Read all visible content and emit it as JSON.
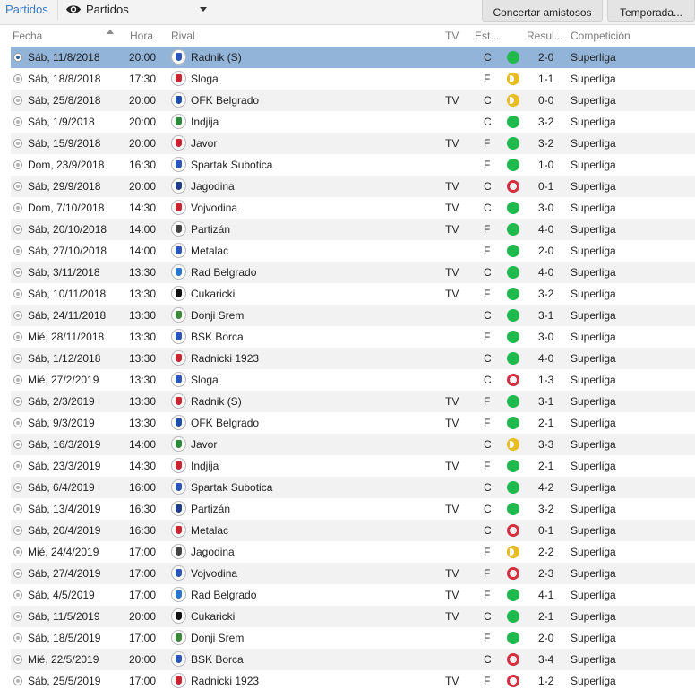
{
  "toolbar": {
    "tab_label": "Partidos",
    "view_label": "Partidos",
    "arrange_friendlies_label": "Concertar amistosos",
    "season_label": "Temporada..."
  },
  "columns": {
    "fecha": "Fecha",
    "hora": "Hora",
    "rival": "Rival",
    "tv": "TV",
    "estadio": "Est...",
    "resultado": "Resul...",
    "competicion": "Competición"
  },
  "colors": {
    "win": "#21b84c",
    "loss": "#d32f3e",
    "draw": "#e8bd23",
    "selected_row": "#92b4d9",
    "accent": "#3a7bc8"
  },
  "matches": [
    {
      "date": "Sáb, 11/8/2018",
      "time": "20:00",
      "rival": "Radnik (S)",
      "tv": "",
      "venue": "C",
      "outcome": "W",
      "score": "2-0",
      "comp": "Superliga"
    },
    {
      "date": "Sáb, 18/8/2018",
      "time": "17:30",
      "rival": "Sloga",
      "tv": "",
      "venue": "F",
      "outcome": "D",
      "score": "1-1",
      "comp": "Superliga"
    },
    {
      "date": "Sáb, 25/8/2018",
      "time": "20:00",
      "rival": "OFK Belgrado",
      "tv": "TV",
      "venue": "C",
      "outcome": "D",
      "score": "0-0",
      "comp": "Superliga"
    },
    {
      "date": "Sáb, 1/9/2018",
      "time": "20:00",
      "rival": "Indjija",
      "tv": "",
      "venue": "C",
      "outcome": "W",
      "score": "3-2",
      "comp": "Superliga"
    },
    {
      "date": "Sáb, 15/9/2018",
      "time": "20:00",
      "rival": "Javor",
      "tv": "TV",
      "venue": "F",
      "outcome": "W",
      "score": "3-2",
      "comp": "Superliga"
    },
    {
      "date": "Dom, 23/9/2018",
      "time": "16:30",
      "rival": "Spartak Subotica",
      "tv": "",
      "venue": "F",
      "outcome": "W",
      "score": "1-0",
      "comp": "Superliga"
    },
    {
      "date": "Sáb, 29/9/2018",
      "time": "20:00",
      "rival": "Jagodina",
      "tv": "TV",
      "venue": "C",
      "outcome": "L",
      "score": "0-1",
      "comp": "Superliga"
    },
    {
      "date": "Dom, 7/10/2018",
      "time": "14:30",
      "rival": "Vojvodina",
      "tv": "TV",
      "venue": "C",
      "outcome": "W",
      "score": "3-0",
      "comp": "Superliga"
    },
    {
      "date": "Sáb, 20/10/2018",
      "time": "14:00",
      "rival": "Partizán",
      "tv": "TV",
      "venue": "F",
      "outcome": "W",
      "score": "4-0",
      "comp": "Superliga"
    },
    {
      "date": "Sáb, 27/10/2018",
      "time": "14:00",
      "rival": "Metalac",
      "tv": "",
      "venue": "F",
      "outcome": "W",
      "score": "2-0",
      "comp": "Superliga"
    },
    {
      "date": "Sáb, 3/11/2018",
      "time": "13:30",
      "rival": "Rad Belgrado",
      "tv": "TV",
      "venue": "C",
      "outcome": "W",
      "score": "4-0",
      "comp": "Superliga"
    },
    {
      "date": "Sáb, 10/11/2018",
      "time": "13:30",
      "rival": "Cukaricki",
      "tv": "TV",
      "venue": "F",
      "outcome": "W",
      "score": "3-2",
      "comp": "Superliga"
    },
    {
      "date": "Sáb, 24/11/2018",
      "time": "13:30",
      "rival": "Donji Srem",
      "tv": "",
      "venue": "C",
      "outcome": "W",
      "score": "3-1",
      "comp": "Superliga"
    },
    {
      "date": "Mié, 28/11/2018",
      "time": "13:30",
      "rival": "BSK Borca",
      "tv": "",
      "venue": "F",
      "outcome": "W",
      "score": "3-0",
      "comp": "Superliga"
    },
    {
      "date": "Sáb, 1/12/2018",
      "time": "13:30",
      "rival": "Radnicki 1923",
      "tv": "",
      "venue": "C",
      "outcome": "W",
      "score": "4-0",
      "comp": "Superliga"
    },
    {
      "date": "Mié, 27/2/2019",
      "time": "13:30",
      "rival": "Sloga",
      "tv": "",
      "venue": "C",
      "outcome": "L",
      "score": "1-3",
      "comp": "Superliga"
    },
    {
      "date": "Sáb, 2/3/2019",
      "time": "13:30",
      "rival": "Radnik (S)",
      "tv": "TV",
      "venue": "F",
      "outcome": "W",
      "score": "3-1",
      "comp": "Superliga"
    },
    {
      "date": "Sáb, 9/3/2019",
      "time": "13:30",
      "rival": "OFK Belgrado",
      "tv": "TV",
      "venue": "F",
      "outcome": "W",
      "score": "2-1",
      "comp": "Superliga"
    },
    {
      "date": "Sáb, 16/3/2019",
      "time": "14:00",
      "rival": "Javor",
      "tv": "",
      "venue": "C",
      "outcome": "D",
      "score": "3-3",
      "comp": "Superliga"
    },
    {
      "date": "Sáb, 23/3/2019",
      "time": "14:30",
      "rival": "Indjija",
      "tv": "TV",
      "venue": "F",
      "outcome": "W",
      "score": "2-1",
      "comp": "Superliga"
    },
    {
      "date": "Sáb, 6/4/2019",
      "time": "16:00",
      "rival": "Spartak Subotica",
      "tv": "",
      "venue": "C",
      "outcome": "W",
      "score": "4-2",
      "comp": "Superliga"
    },
    {
      "date": "Sáb, 13/4/2019",
      "time": "16:30",
      "rival": "Partizán",
      "tv": "TV",
      "venue": "C",
      "outcome": "W",
      "score": "3-2",
      "comp": "Superliga"
    },
    {
      "date": "Sáb, 20/4/2019",
      "time": "16:30",
      "rival": "Metalac",
      "tv": "",
      "venue": "C",
      "outcome": "L",
      "score": "0-1",
      "comp": "Superliga"
    },
    {
      "date": "Mié, 24/4/2019",
      "time": "17:00",
      "rival": "Jagodina",
      "tv": "",
      "venue": "F",
      "outcome": "D",
      "score": "2-2",
      "comp": "Superliga"
    },
    {
      "date": "Sáb, 27/4/2019",
      "time": "17:00",
      "rival": "Vojvodina",
      "tv": "TV",
      "venue": "F",
      "outcome": "L",
      "score": "2-3",
      "comp": "Superliga"
    },
    {
      "date": "Sáb, 4/5/2019",
      "time": "17:00",
      "rival": "Rad Belgrado",
      "tv": "TV",
      "venue": "F",
      "outcome": "W",
      "score": "4-1",
      "comp": "Superliga"
    },
    {
      "date": "Sáb, 11/5/2019",
      "time": "20:00",
      "rival": "Cukaricki",
      "tv": "TV",
      "venue": "C",
      "outcome": "W",
      "score": "2-1",
      "comp": "Superliga"
    },
    {
      "date": "Sáb, 18/5/2019",
      "time": "17:00",
      "rival": "Donji Srem",
      "tv": "",
      "venue": "F",
      "outcome": "W",
      "score": "2-0",
      "comp": "Superliga"
    },
    {
      "date": "Mié, 22/5/2019",
      "time": "20:00",
      "rival": "BSK Borca",
      "tv": "",
      "venue": "C",
      "outcome": "L",
      "score": "3-4",
      "comp": "Superliga"
    },
    {
      "date": "Sáb, 25/5/2019",
      "time": "17:00",
      "rival": "Radnicki 1923",
      "tv": "TV",
      "venue": "F",
      "outcome": "L",
      "score": "1-2",
      "comp": "Superliga"
    }
  ]
}
